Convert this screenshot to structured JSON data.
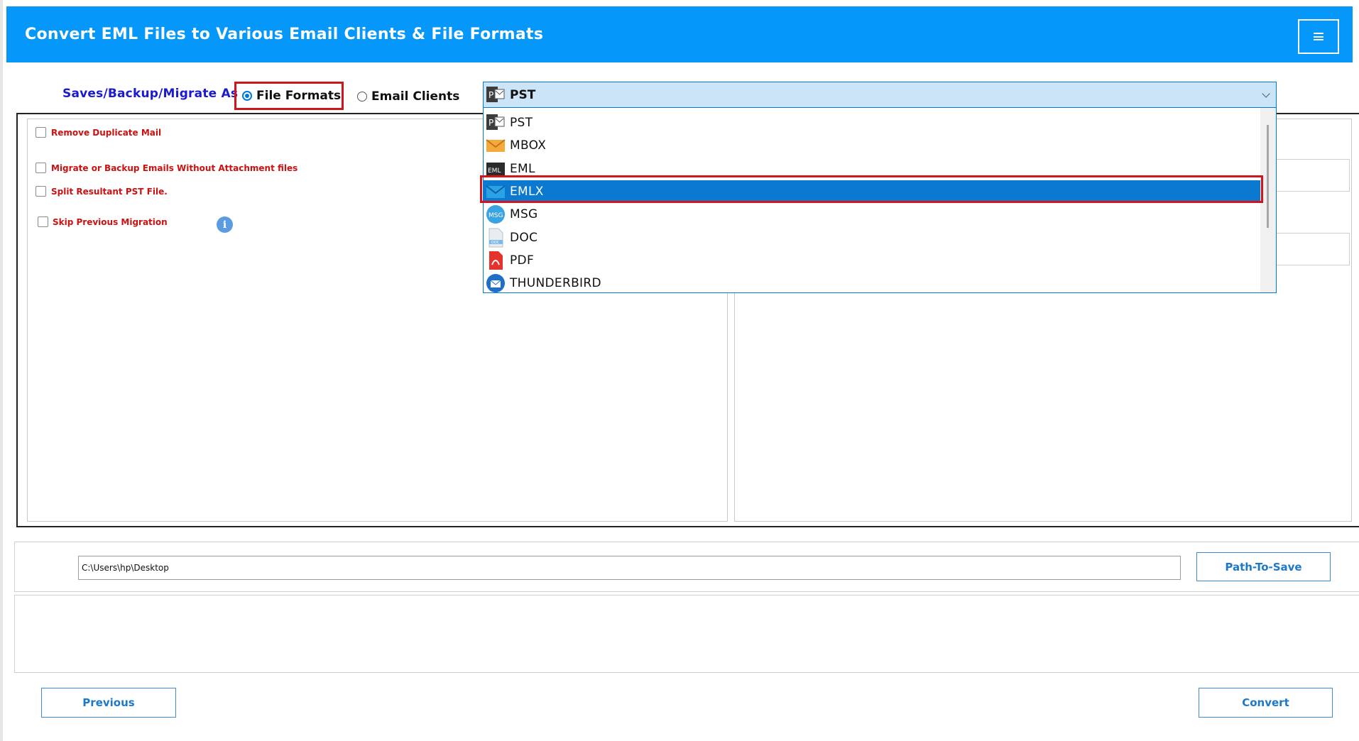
{
  "header": {
    "title": "Convert EML Files to Various Email Clients & File Formats",
    "menu_icon": "hamburger-icon"
  },
  "save_as": {
    "label": "Saves/Backup/Migrate As",
    "option_file_formats": "File Formats",
    "option_email_clients": "Email Clients",
    "selected": "File Formats"
  },
  "format_select": {
    "value": "PST",
    "items": [
      {
        "label": "PST",
        "icon": "pst-icon"
      },
      {
        "label": "MBOX",
        "icon": "mbox-icon"
      },
      {
        "label": "EML",
        "icon": "eml-icon"
      },
      {
        "label": "EMLX",
        "icon": "emlx-icon",
        "highlighted": true
      },
      {
        "label": "MSG",
        "icon": "msg-icon"
      },
      {
        "label": "DOC",
        "icon": "doc-icon"
      },
      {
        "label": "PDF",
        "icon": "pdf-icon"
      },
      {
        "label": "THUNDERBIRD",
        "icon": "thunderbird-icon"
      }
    ]
  },
  "options": {
    "remove_duplicate": "Remove Duplicate Mail",
    "without_attachment": "Migrate or Backup Emails Without Attachment files",
    "split_pst": "Split Resultant PST File.",
    "skip_previous": "Skip Previous Migration",
    "info_glyph": "i"
  },
  "path": {
    "value": "C:\\Users\\hp\\Desktop",
    "button": "Path-To-Save"
  },
  "footer": {
    "previous": "Previous",
    "convert": "Convert"
  },
  "colors": {
    "header": "#0697fb",
    "highlight": "#0b79d0",
    "accent_red": "#d0151c",
    "option_text": "#cc1111"
  }
}
